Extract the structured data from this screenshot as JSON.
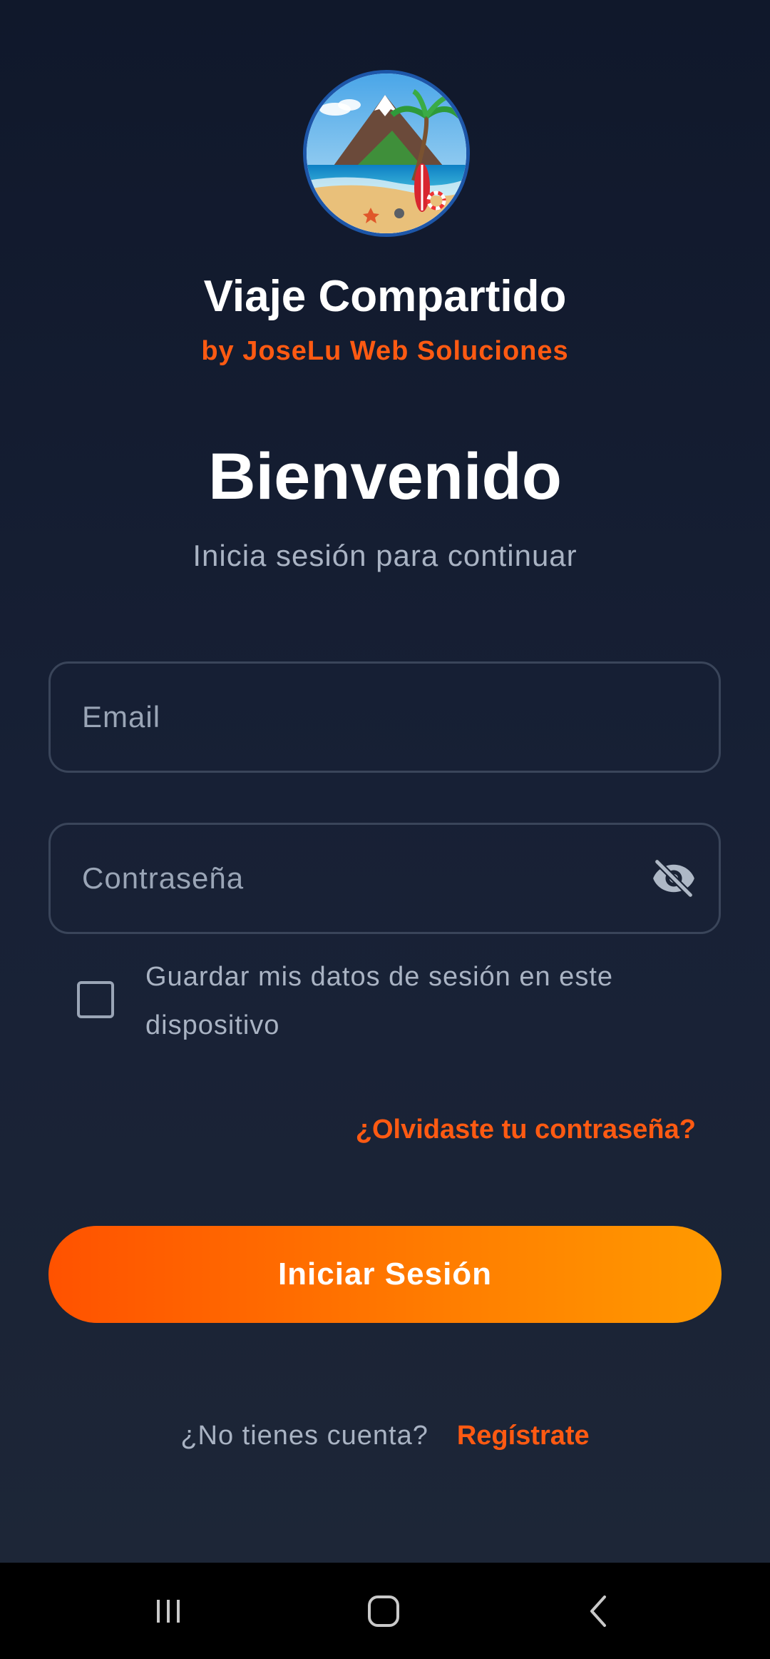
{
  "app": {
    "title": "Viaje Compartido",
    "subtitle": "by JoseLu Web Soluciones",
    "accent_color": "#ff5a12",
    "logo_icon": "beach-mountain-logo"
  },
  "welcome": {
    "heading": "Bienvenido",
    "subheading": "Inicia sesión para continuar"
  },
  "form": {
    "email_placeholder": "Email",
    "password_placeholder": "Contraseña",
    "password_toggle_icon": "eye-off-icon",
    "remember_label": "Guardar mis datos de sesión en este dispositivo",
    "remember_checked": false,
    "forgot_link": "¿Olvidaste tu contraseña?",
    "submit_label": "Iniciar Sesión"
  },
  "signup": {
    "question": "¿No tienes cuenta?",
    "link": "Regístrate"
  },
  "system_nav": {
    "recents_icon": "recents-icon",
    "home_icon": "home-icon",
    "back_icon": "back-icon"
  }
}
